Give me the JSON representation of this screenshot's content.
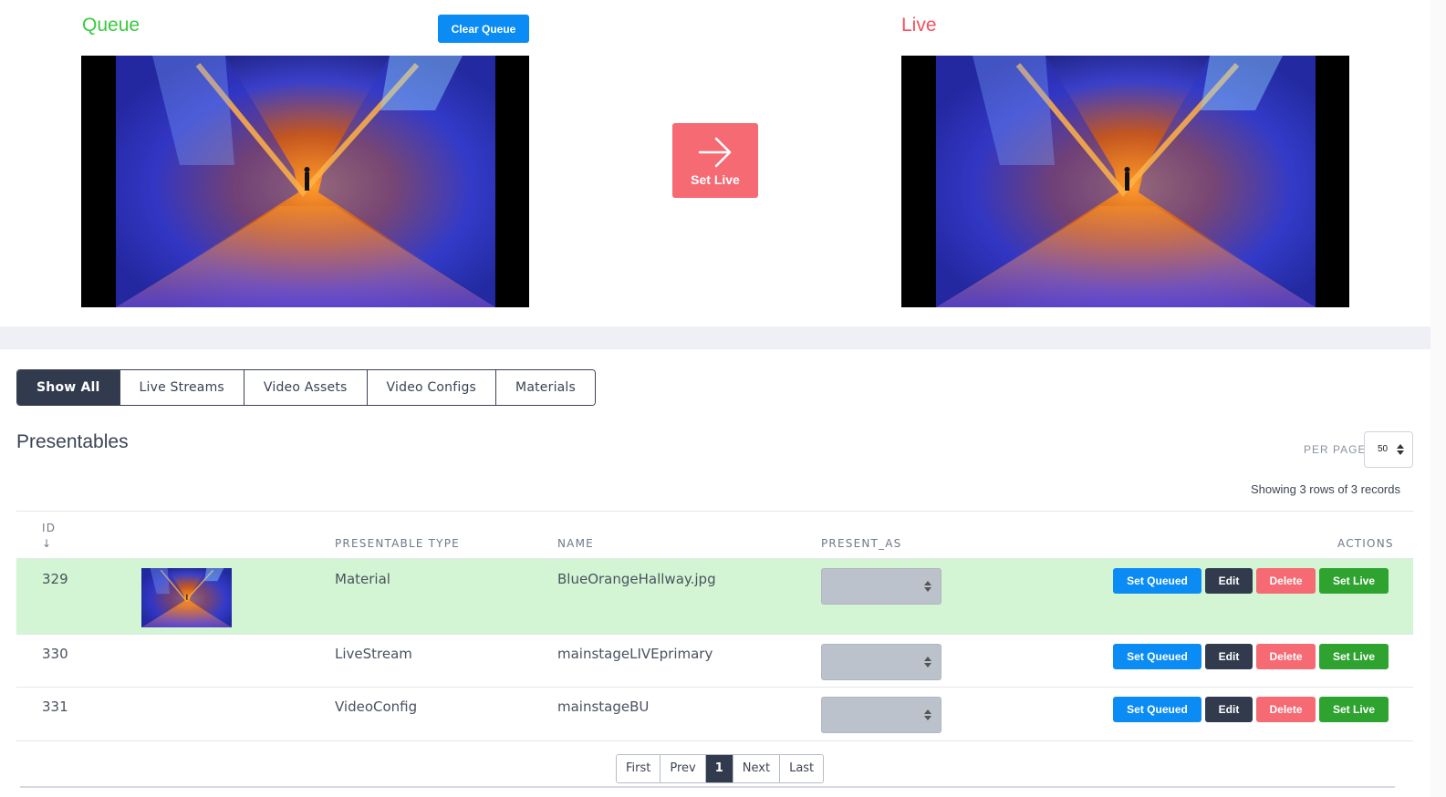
{
  "queue": {
    "title": "Queue",
    "clear_label": "Clear Queue"
  },
  "live": {
    "title": "Live"
  },
  "set_live_button": {
    "label": "Set Live"
  },
  "filters": {
    "tabs": [
      {
        "label": "Show All",
        "active": true
      },
      {
        "label": "Live Streams",
        "active": false
      },
      {
        "label": "Video Assets",
        "active": false
      },
      {
        "label": "Video Configs",
        "active": false
      },
      {
        "label": "Materials",
        "active": false
      }
    ]
  },
  "presentables": {
    "title": "Presentables",
    "per_page_label": "PER PAGE",
    "per_page_value": "50",
    "records_info": "Showing 3 rows of 3 records",
    "columns": {
      "id": "ID",
      "sort_icon": "↓",
      "type": "PRESENTABLE TYPE",
      "name": "NAME",
      "present_as": "PRESENT_AS",
      "actions": "ACTIONS"
    },
    "rows": [
      {
        "id": "329",
        "type": "Material",
        "name": "BlueOrangeHallway.jpg",
        "has_thumbnail": true,
        "highlighted": true
      },
      {
        "id": "330",
        "type": "LiveStream",
        "name": "mainstageLIVEprimary",
        "has_thumbnail": false,
        "highlighted": false
      },
      {
        "id": "331",
        "type": "VideoConfig",
        "name": "mainstageBU",
        "has_thumbnail": false,
        "highlighted": false
      }
    ],
    "row_actions": {
      "queued_label": "Set Queued",
      "edit_label": "Edit",
      "delete_label": "Delete",
      "live_label": "Set Live"
    }
  },
  "pagination": {
    "first": "First",
    "prev": "Prev",
    "current": "1",
    "next": "Next",
    "last": "Last"
  },
  "colors": {
    "queue_title": "#37cc3c",
    "live_title": "#f5505e",
    "primary": "#0b8cf5",
    "dark": "#323b4e",
    "danger": "#f56a73",
    "success": "#2fa32f",
    "highlight_row": "#d3f5d3"
  },
  "icons": {
    "set_live": "arrow-right-icon",
    "select_caret": "sort-caret-icon",
    "sort": "arrow-down-icon"
  }
}
